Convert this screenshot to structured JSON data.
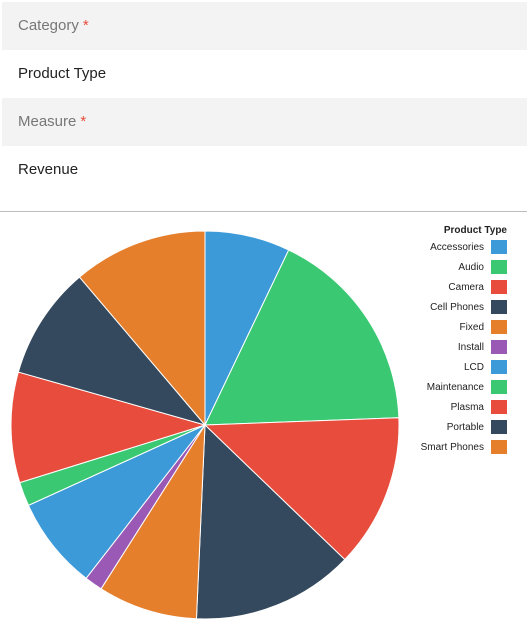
{
  "category": {
    "label": "Category",
    "required_marker": "*",
    "value": "Product Type"
  },
  "measure": {
    "label": "Measure",
    "required_marker": "*",
    "value": "Revenue"
  },
  "chart_data": {
    "type": "pie",
    "legend_title": "Product Type",
    "legend_position": "top-right",
    "start": "12 o'clock",
    "direction": "clockwise",
    "slices": [
      {
        "label": "Accessories",
        "value": 7.1,
        "color": "#3d9ad9"
      },
      {
        "label": "Audio",
        "value": 17.3,
        "color": "#3ac873"
      },
      {
        "label": "Camera",
        "value": 12.8,
        "color": "#e74c3c"
      },
      {
        "label": "Cell Phones",
        "value": 13.5,
        "color": "#34495e"
      },
      {
        "label": "Fixed",
        "value": 8.3,
        "color": "#e67f2c"
      },
      {
        "label": "Install",
        "value": 1.5,
        "color": "#9b59b6"
      },
      {
        "label": "LCD",
        "value": 7.7,
        "color": "#3d9ad9"
      },
      {
        "label": "Maintenance",
        "value": 2.0,
        "color": "#3ac873"
      },
      {
        "label": "Plasma",
        "value": 9.2,
        "color": "#e74c3c"
      },
      {
        "label": "Portable",
        "value": 9.4,
        "color": "#34495e"
      },
      {
        "label": "Smart Phones",
        "value": 11.2,
        "color": "#e67f2c"
      }
    ]
  }
}
